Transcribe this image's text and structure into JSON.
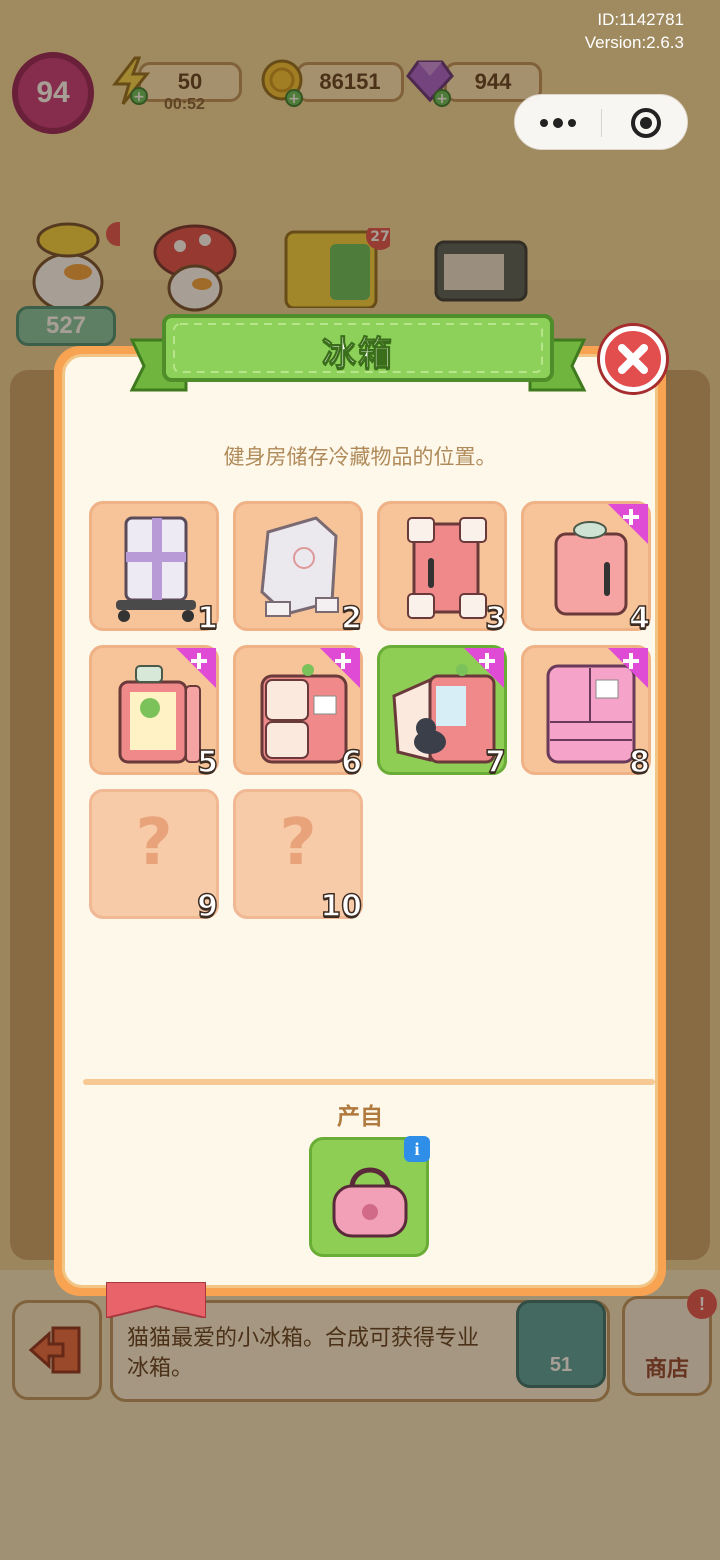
{
  "meta": {
    "id_label": "ID:1142781",
    "version_label": "Version:2.6.3"
  },
  "hud": {
    "level": "94",
    "energy_value": "50",
    "energy_timer": "00:52",
    "coins_value": "86151",
    "gems_value": "944"
  },
  "background": {
    "badge_count": "27",
    "star_count": "527",
    "item_description": "猫猫最爱的小冰箱。合成可获得专业冰箱。",
    "coin_price": "51",
    "shop_label": "商店",
    "shop_badge": "!"
  },
  "modal": {
    "title": "冰箱",
    "description": "健身房储存冷藏物品的位置。",
    "source_label": "产自",
    "items": [
      {
        "number": "1",
        "name": "packed-fridge-on-dolly"
      },
      {
        "number": "2",
        "name": "wrapped-fridge"
      },
      {
        "number": "3",
        "name": "fridge-with-foam-corners"
      },
      {
        "number": "4",
        "name": "pink-fridge-with-cup",
        "has_plus": true
      },
      {
        "number": "5",
        "name": "open-fridge-with-frog",
        "has_plus": true
      },
      {
        "number": "6",
        "name": "cream-fridge-with-plant",
        "has_plus": true
      },
      {
        "number": "7",
        "name": "open-fridge-with-cat",
        "has_plus": true,
        "selected": true
      },
      {
        "number": "8",
        "name": "french-door-fridge",
        "has_plus": true
      },
      {
        "number": "9",
        "name": "unknown",
        "locked": true,
        "glyph": "?"
      },
      {
        "number": "10",
        "name": "unknown",
        "locked": true,
        "glyph": "?"
      }
    ],
    "source_info_glyph": "i"
  },
  "colors": {
    "modal_border": "#f7a352",
    "tile_bg": "#f7c49a",
    "tile_selected": "#8fce55",
    "banner_green": "#8dd05a",
    "close_red": "#e24d4d",
    "plus_magenta": "#e04bd6"
  }
}
